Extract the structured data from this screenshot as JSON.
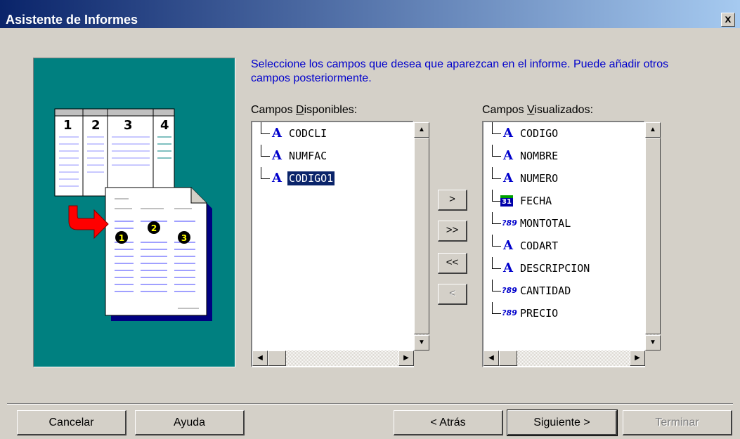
{
  "window": {
    "title": "Asistente de Informes",
    "close_label": "x"
  },
  "instructions": "Seleccione los campos que desea que aparezcan en el informe. Puede añadir otros campos posteriormente.",
  "available": {
    "label_prefix": "Campos ",
    "label_accel": "D",
    "label_rest": "isponibles:",
    "items": [
      {
        "name": "CODCLI",
        "type_icon": "text-field-icon",
        "selected": false
      },
      {
        "name": "NUMFAC",
        "type_icon": "text-field-icon",
        "selected": false
      },
      {
        "name": "CODIGO1",
        "type_icon": "text-field-icon",
        "selected": true
      }
    ]
  },
  "displayed": {
    "label_prefix": "Campos ",
    "label_accel": "V",
    "label_rest": "isualizados:",
    "items": [
      {
        "name": "CODIGO",
        "type_icon": "text-field-icon"
      },
      {
        "name": "NOMBRE",
        "type_icon": "text-field-icon"
      },
      {
        "name": "NUMERO",
        "type_icon": "text-field-icon"
      },
      {
        "name": "FECHA",
        "type_icon": "date-field-icon"
      },
      {
        "name": "MONTOTAL",
        "type_icon": "numeric-field-icon"
      },
      {
        "name": "CODART",
        "type_icon": "text-field-icon"
      },
      {
        "name": "DESCRIPCION",
        "type_icon": "text-field-icon"
      },
      {
        "name": "CANTIDAD",
        "type_icon": "numeric-field-icon"
      },
      {
        "name": "PRECIO",
        "type_icon": "numeric-field-icon"
      }
    ]
  },
  "icons": {
    "text_glyph": "A",
    "date_glyph": "31",
    "numeric_glyph": "?89"
  },
  "move_buttons": {
    "add_one": ">",
    "add_all": ">>",
    "remove_all": "<<",
    "remove_one": "<"
  },
  "illustration": {
    "columns": [
      "1",
      "2",
      "3",
      "4"
    ],
    "order_markers": [
      "1",
      "2",
      "3"
    ]
  },
  "footer": {
    "cancel": "Cancelar",
    "help": "Ayuda",
    "back": "< Atrás",
    "next": "Siguiente >",
    "finish": "Terminar"
  },
  "colors": {
    "title_bar": "#0a246a",
    "illustration_bg": "#008080",
    "instruction_text": "#0000cc",
    "selection": "#0a246a"
  }
}
